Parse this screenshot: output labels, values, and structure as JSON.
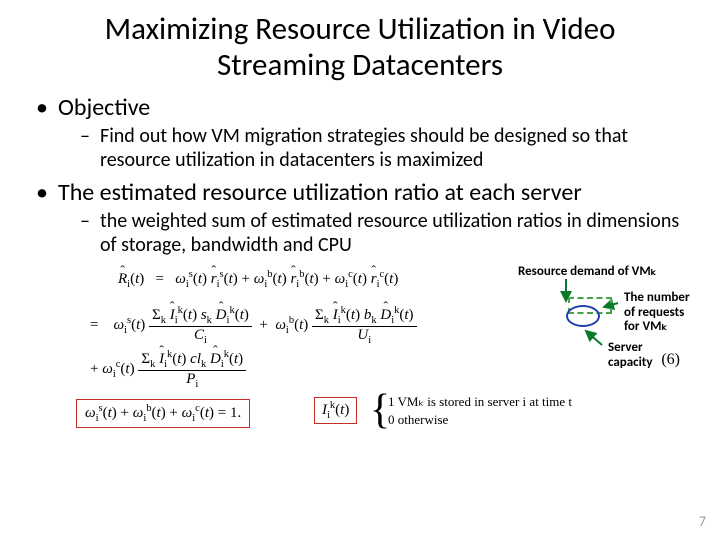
{
  "title": "Maximizing Resource Utilization in Video Streaming Datacenters",
  "bullets": {
    "b1": "Objective",
    "b1_sub": "Find out how VM migration strategies should be designed so that resource utilization in datacenters is maximized",
    "b2": "The estimated resource utilization ratio at each server",
    "b2_sub": "the weighted sum of estimated resource utilization ratios in dimensions of storage, bandwidth and CPU"
  },
  "annotations": {
    "a1": "Resource demand of VMₖ",
    "a2": "The number of requests for VMₖ",
    "a3": "Server capacity"
  },
  "equations": {
    "line1_lhs": "R̂ᵢ(t)",
    "line1_rhs": "ωᵢˢ(t) r̂ᵢˢ(t) + ωᵢᵇ(t) r̂ᵢᵇ(t) + ωᵢᶜ(t) r̂ᵢᶜ(t)",
    "line2_pre": "=   ωᵢˢ(t)",
    "line2_frac_num": "Σₖ Îᵢᵏ(t) sₖ D̂ᵢᵏ(t)",
    "line2_frac_den": "Cᵢ",
    "line2_mid": " + ωᵢᵇ(t)",
    "line2b_frac_num": "Σₖ Îᵢᵏ(t) bₖ D̂ᵢᵏ(t)",
    "line2b_frac_den": "Uᵢ",
    "line3_pre": "+ ωᵢᶜ(t)",
    "line3_frac_num": "Σₖ Îᵢᵏ(t) clₖ D̂ᵢᵏ(t)",
    "line3_frac_den": "Pᵢ",
    "omega_constraint": "ωᵢˢ(t) + ωᵢᵇ(t) + ωᵢᶜ(t) = 1.",
    "ik": "Iᵢᵏ(t)",
    "cases_1": "1   VMₖ is stored in server i at time t",
    "cases_0": "0   otherwise",
    "num": "(6)"
  },
  "page": "7"
}
